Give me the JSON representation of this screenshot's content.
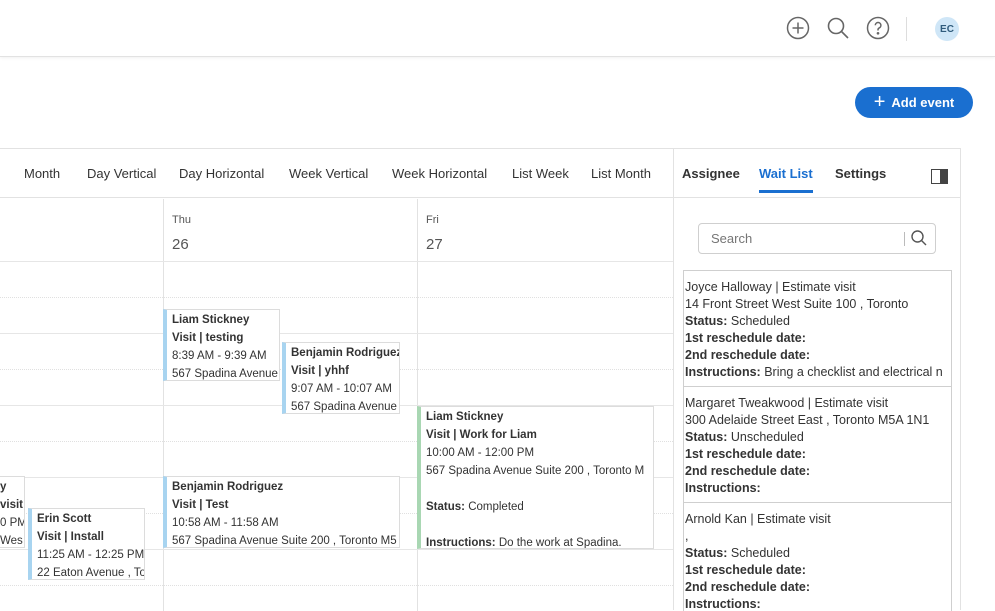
{
  "topbar": {
    "icons": [
      "add-circle-icon",
      "search-icon",
      "help-icon"
    ],
    "avatar_initials": "EC"
  },
  "add_event": {
    "label": "Add event"
  },
  "calendar": {
    "views": {
      "partial": "ı",
      "month": "Month",
      "day_vertical": "Day Vertical",
      "day_horizontal": "Day Horizontal",
      "week_vertical": "Week Vertical",
      "week_horizontal": "Week Horizontal",
      "list_week": "List Week",
      "list_month": "List Month"
    },
    "days": [
      {
        "name": "Thu",
        "num": "26"
      },
      {
        "name": "Fri",
        "num": "27"
      }
    ],
    "events": {
      "e1": {
        "name": "Liam Stickney",
        "type": "Visit | testing",
        "time": "8:39 AM - 9:39 AM",
        "address": "567 Spadina Avenue"
      },
      "e2": {
        "name": "Benjamin Rodriguez",
        "type": "Visit | yhhf",
        "time": "9:07 AM - 10:07 AM",
        "address": "567 Spadina Avenue"
      },
      "e3": {
        "name": "Liam Stickney",
        "type": "Visit | Work for Liam",
        "time": "10:00 AM - 12:00 PM",
        "address": "567 Spadina Avenue Suite 200 , Toronto M",
        "status_label": "Status:",
        "status": "Completed",
        "instructions_label": "Instructions:",
        "instructions": "Do the work at Spadina."
      },
      "e4": {
        "name": "Benjamin Rodriguez",
        "type": "Visit | Test",
        "time": "10:58 AM - 11:58 AM",
        "address": "567 Spadina Avenue Suite 200 , Toronto M5"
      },
      "e5": {
        "name": "y",
        "type": "visit",
        "time": "0 PM",
        "address": "Wes"
      },
      "e6": {
        "name": "Erin Scott",
        "type": "Visit | Install",
        "time": "11:25 AM - 12:25 PM",
        "address": "22 Eaton Avenue , To"
      }
    }
  },
  "sidebar": {
    "tabs": {
      "assignee": "Assignee",
      "wait_list": "Wait List",
      "settings": "Settings"
    },
    "search_placeholder": "Search",
    "labels": {
      "status": "Status:",
      "first_reschedule": "1st reschedule date:",
      "second_reschedule": "2nd reschedule date:",
      "instructions": "Instructions:"
    },
    "wait_list": [
      {
        "title": "Joyce Halloway | Estimate visit",
        "address": "14 Front Street West Suite 100 , Toronto",
        "status": "Scheduled",
        "instructions": "Bring a checklist and electrical n"
      },
      {
        "title": "Margaret Tweakwood | Estimate visit",
        "address": "300 Adelaide Street East , Toronto M5A 1N1",
        "status": "Unscheduled",
        "instructions": ""
      },
      {
        "title": "Arnold Kan | Estimate visit",
        "address": ",",
        "status": "Scheduled",
        "instructions": ""
      }
    ]
  },
  "colors": {
    "accent": "#1a6fd0",
    "event_border_blue": "#a8d4f0",
    "event_border_green": "#a9d7b3"
  }
}
